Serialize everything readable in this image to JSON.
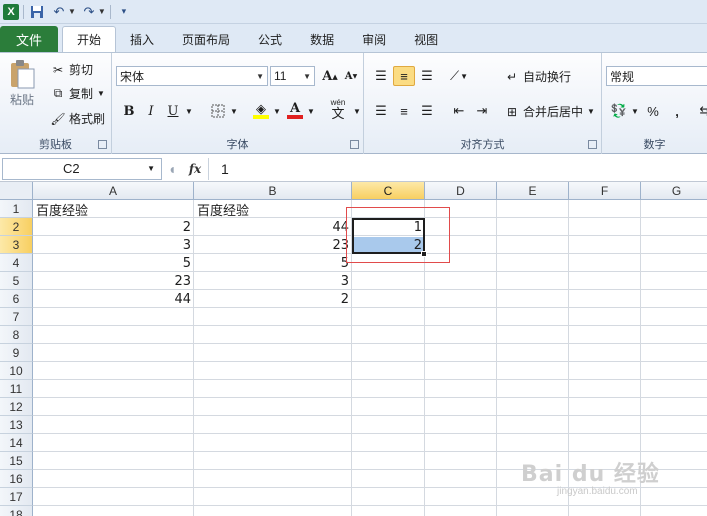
{
  "app": {
    "logo_letter": "X"
  },
  "quick_access": {
    "save_icon": "save-icon",
    "undo_icon": "undo-icon",
    "redo_icon": "redo-icon",
    "customize_icon": "customize-icon"
  },
  "tabs": {
    "file": "文件",
    "items": [
      "开始",
      "插入",
      "页面布局",
      "公式",
      "数据",
      "审阅",
      "视图"
    ],
    "active": "开始"
  },
  "ribbon": {
    "clipboard": {
      "label": "剪贴板",
      "paste": "粘贴",
      "cut": "剪切",
      "copy": "复制",
      "format_painter": "格式刷"
    },
    "font": {
      "label": "字体",
      "font_name": "宋体",
      "font_size": "11",
      "bold": "B",
      "italic": "I",
      "underline": "U",
      "grow": "A",
      "shrink": "A",
      "wen": "wén"
    },
    "alignment": {
      "label": "对齐方式",
      "wrap_text": "自动换行",
      "merge_center": "合并后居中"
    },
    "number": {
      "label": "数字",
      "format": "常规",
      "percent": "%",
      "comma": ","
    }
  },
  "formula_bar": {
    "name_box": "C2",
    "fx": "fx",
    "value": "1"
  },
  "grid": {
    "columns": [
      "A",
      "B",
      "C",
      "D",
      "E",
      "F",
      "G"
    ],
    "selected_column": "C",
    "rows": [
      "1",
      "2",
      "3",
      "4",
      "5",
      "6",
      "7",
      "8",
      "9",
      "10",
      "11",
      "12",
      "13",
      "14",
      "15",
      "16",
      "17",
      "18"
    ],
    "selected_rows": [
      "2",
      "3"
    ],
    "cells": {
      "A1": "百度经验",
      "B1": "百度经验",
      "A2": "2",
      "B2": "44",
      "C2": "1",
      "A3": "3",
      "B3": "23",
      "C3": "2",
      "A4": "5",
      "B4": "5",
      "A5": "23",
      "B5": "3",
      "A6": "44",
      "B6": "2"
    }
  },
  "watermark": {
    "text": "Bai du 经验",
    "sub": "jingyan.baidu.com"
  },
  "colors": {
    "file_tab": "#2b7d3a",
    "selection_fill": "#a9c9ec",
    "highlight_box": "#e14b4b",
    "header_selected": "#f8cf61"
  }
}
